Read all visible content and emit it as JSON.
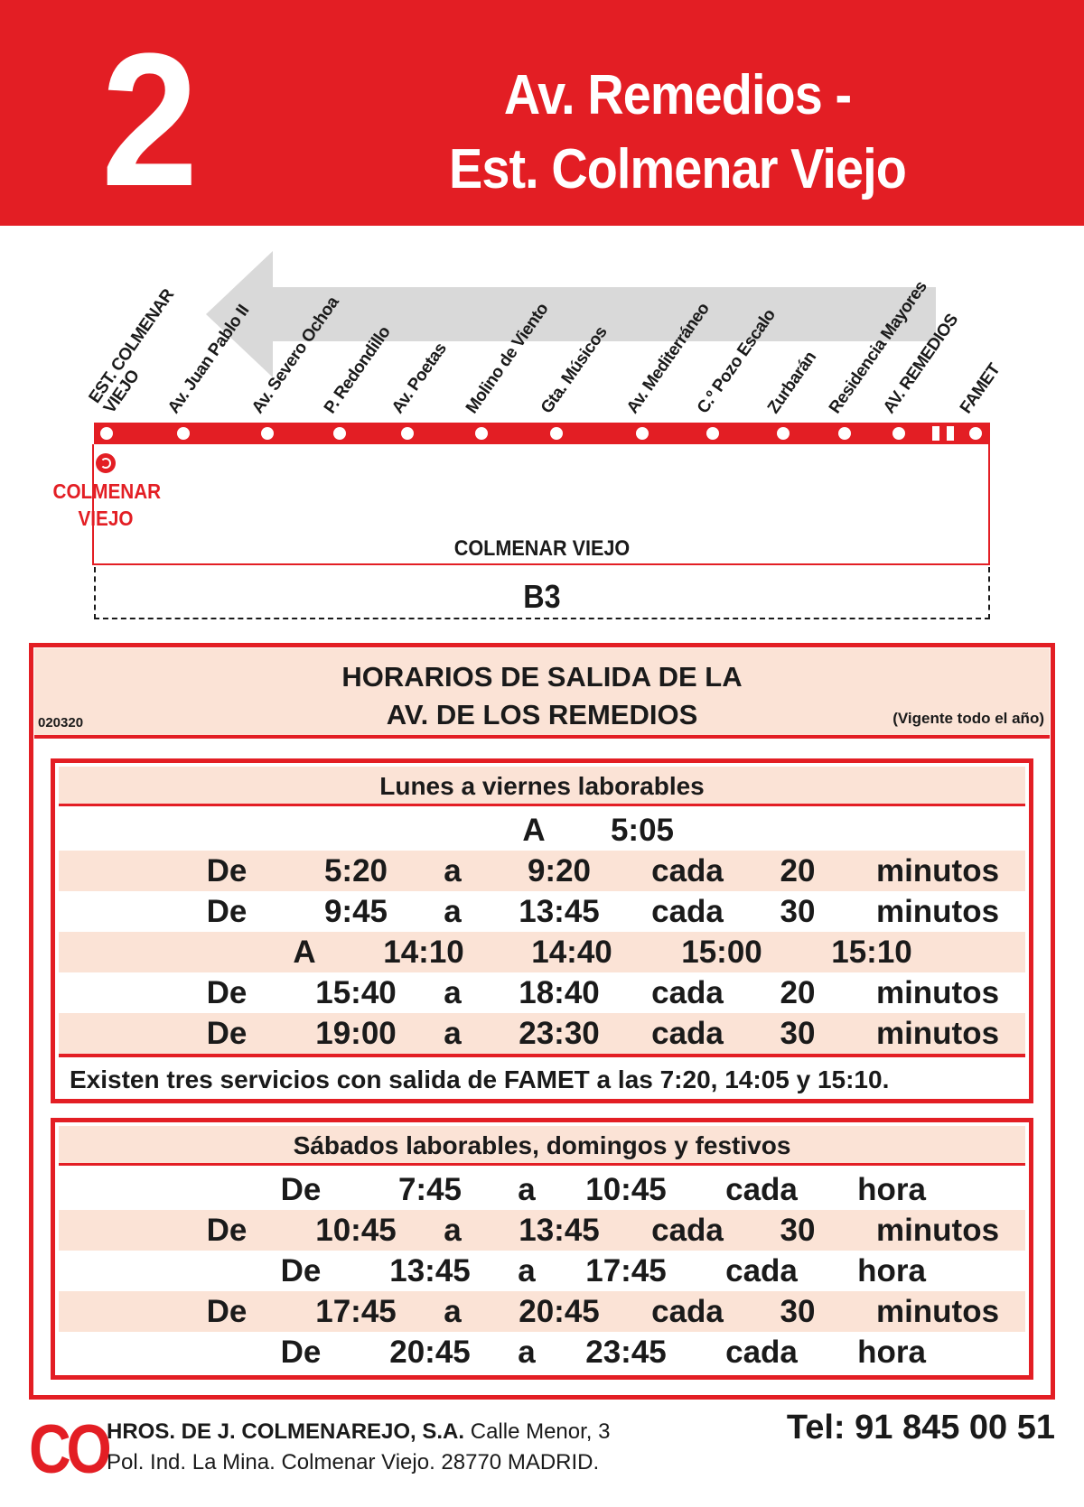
{
  "header": {
    "route_number": "2",
    "title_line1": "Av. Remedios -",
    "title_line2": "Est. Colmenar Viejo"
  },
  "colors": {
    "brand_red": "#e31e24",
    "shade": "#fbe3d6",
    "arrow_gray": "#d9d9d9"
  },
  "diagram": {
    "stops": [
      "EST. COLMENAR\nVIEJO",
      "Av. Juan Pablo II",
      "Av. Severo Ochoa",
      "P. Redondillo",
      "Av. Poetas",
      "Molino de Viento",
      "Gta. Músicos",
      "Av. Mediterráneo",
      "C.º Pozo Escalo",
      "Zurbarán",
      "Residencia Mayores",
      "AV. REMEDIOS",
      "FAMET"
    ],
    "start_town": "COLMENAR\nVIEJO",
    "town": "COLMENAR VIEJO",
    "zone": "B3"
  },
  "schedule": {
    "title_line1": "HORARIOS DE SALIDA DE LA",
    "title_line2": "AV. DE LOS REMEDIOS",
    "code": "020320",
    "validity": "(Vigente todo el año)",
    "weekdays": {
      "heading": "Lunes a viernes laborables",
      "rows": [
        [
          "A",
          "5:05"
        ],
        [
          "De",
          "5:20",
          "a",
          "9:20",
          "cada",
          "20",
          "minutos"
        ],
        [
          "De",
          "9:45",
          "a",
          "13:45",
          "cada",
          "30",
          "minutos"
        ],
        [
          "A",
          "14:10",
          "14:40",
          "15:00",
          "15:10"
        ],
        [
          "De",
          "15:40",
          "a",
          "18:40",
          "cada",
          "20",
          "minutos"
        ],
        [
          "De",
          "19:00",
          "a",
          "23:30",
          "cada",
          "30",
          "minutos"
        ]
      ],
      "note": "Existen tres servicios con salida de FAMET a las 7:20, 14:05 y 15:10."
    },
    "weekends": {
      "heading": "Sábados laborables, domingos y festivos",
      "rows": [
        [
          "De",
          "7:45",
          "a",
          "10:45",
          "cada",
          "hora"
        ],
        [
          "De",
          "10:45",
          "a",
          "13:45",
          "cada",
          "30",
          "minutos"
        ],
        [
          "De",
          "13:45",
          "a",
          "17:45",
          "cada",
          "hora"
        ],
        [
          "De",
          "17:45",
          "a",
          "20:45",
          "cada",
          "30",
          "minutos"
        ],
        [
          "De",
          "20:45",
          "a",
          "23:45",
          "cada",
          "hora"
        ]
      ]
    }
  },
  "footer": {
    "logo": "CO",
    "company_name": "HROS. DE J. COLMENAREJO, S.A.",
    "address1": " Calle Menor, 3",
    "address2": "Pol. Ind. La Mina. Colmenar Viejo. 28770 MADRID.",
    "tel": "Tel: 91 845 00 51"
  }
}
